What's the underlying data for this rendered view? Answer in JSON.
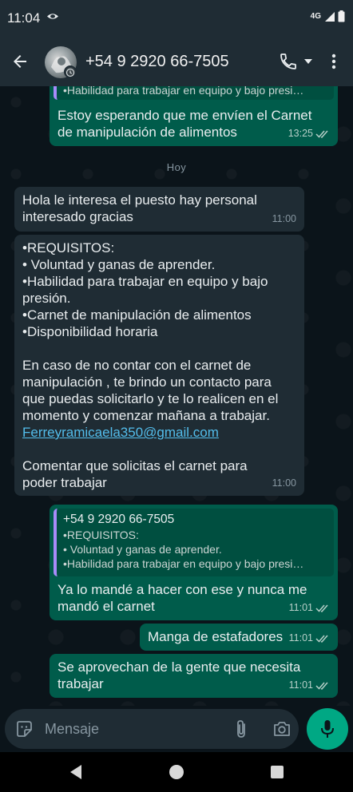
{
  "status_bar": {
    "time": "11:04",
    "network": "4G"
  },
  "header": {
    "contact": "+54 9 2920 66-7505"
  },
  "chat": {
    "m1": {
      "quote_line": "•Habilidad para trabajar en equipo y bajo presi…",
      "lines": [
        "Estoy esperando que me envíen el Carnet",
        "de manipulación de alimentos"
      ],
      "time": "13:25"
    },
    "date_chip": "Hoy",
    "m2": {
      "lines": [
        "Hola le interesa el puesto hay personal",
        "interesado gracias"
      ],
      "time": "11:00"
    },
    "m3": {
      "lines": [
        "•REQUISITOS:",
        "• Voluntad y ganas de aprender.",
        "•Habilidad para trabajar en equipo y bajo",
        "presión.",
        "•Carnet de manipulación de alimentos",
        "•Disponibilidad horaria",
        "",
        "En caso de no contar con el carnet de",
        "manipulación , te brindo un contacto para",
        "que puedas solicitarlo y te lo realicen en el",
        "momento y comenzar mañana a trabajar."
      ],
      "email": "Ferreyramicaela350@gmail.com",
      "lines2": [
        "",
        "Comentar que solicitas el carnet para",
        "poder trabajar"
      ],
      "time": "11:00"
    },
    "m4": {
      "quote_author": "+54 9 2920 66-7505",
      "quote_lines": [
        "•REQUISITOS:",
        "• Voluntad y ganas de aprender.",
        "•Habilidad para trabajar en equipo y bajo presi…"
      ],
      "lines": [
        "Ya lo mandé a hacer con ese y nunca me",
        "mandó el carnet"
      ],
      "time": "11:01"
    },
    "m5": {
      "text": "Manga de estafadores",
      "time": "11:01"
    },
    "m6": {
      "lines": [
        "Se aprovechan de la gente que necesita",
        "trabajar"
      ],
      "time": "11:01"
    }
  },
  "composer": {
    "placeholder": "Mensaje"
  },
  "colors": {
    "outgoing": "#005c4b",
    "incoming": "#1f2c34",
    "accent": "#00a884",
    "link": "#53bdeb"
  }
}
